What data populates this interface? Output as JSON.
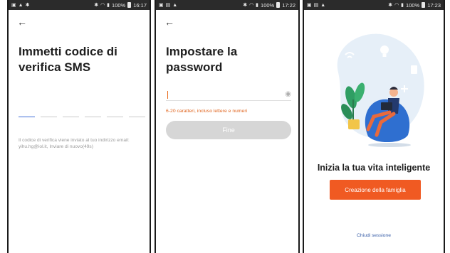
{
  "screen1": {
    "status": {
      "right": "100%",
      "time": "16:17"
    },
    "title": "Immetti codice di verifica SMS",
    "code_cells": [
      "",
      "",
      "",
      "",
      "",
      ""
    ],
    "hint": "Il codice di verifica viene inviato al tuo indirizzo email: yihu.hg@iol.it, Inviare di nuovo(49s)"
  },
  "screen2": {
    "status": {
      "right": "100%",
      "time": "17:22"
    },
    "title": "Impostare la password",
    "password_value": "",
    "password_hint": "6-20 caratteri, incluso lettere e numeri",
    "done_label": "Fine"
  },
  "screen3": {
    "status": {
      "right": "100%",
      "time": "17:23"
    },
    "welcome": "Inizia la tua vita inteligente",
    "create_label": "Creazione della famiglia",
    "logout_label": "Chiudi sessione"
  },
  "colors": {
    "accent": "#f05a22",
    "active_underline": "#3f6ed8",
    "link": "#3a5fa8",
    "disabled_button": "#d6d6d6"
  }
}
